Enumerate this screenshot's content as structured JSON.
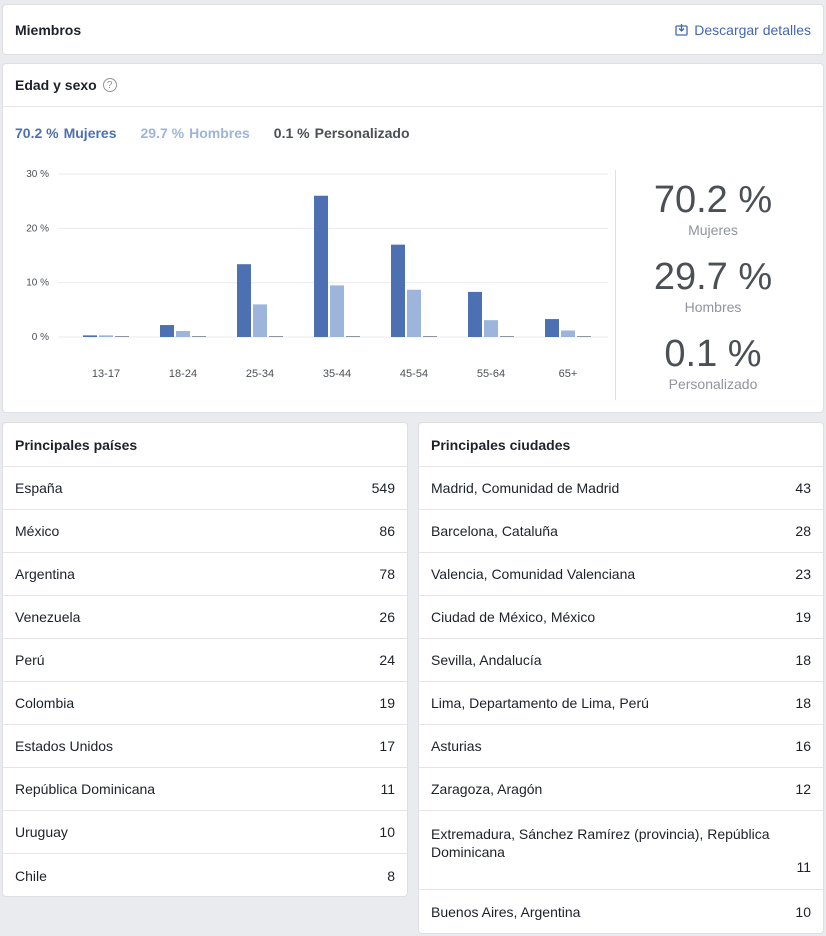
{
  "members": {
    "title": "Miembros",
    "download_label": "Descargar detalles"
  },
  "age_gender": {
    "title": "Edad y sexo",
    "help": "?",
    "legend": [
      {
        "pct": "70.2 %",
        "label": "Mujeres"
      },
      {
        "pct": "29.7 %",
        "label": "Hombres"
      },
      {
        "pct": "0.1 %",
        "label": "Personalizado"
      }
    ],
    "stats": [
      {
        "value": "70.2 %",
        "label": "Mujeres"
      },
      {
        "value": "29.7 %",
        "label": "Hombres"
      },
      {
        "value": "0.1 %",
        "label": "Personalizado"
      }
    ]
  },
  "chart_data": {
    "type": "bar",
    "categories": [
      "13-17",
      "18-24",
      "25-34",
      "35-44",
      "45-54",
      "55-64",
      "65+"
    ],
    "series": [
      {
        "name": "Mujeres",
        "color": "#4d70b2",
        "values": [
          0.3,
          2.2,
          13.4,
          26.0,
          17.0,
          8.3,
          3.3
        ]
      },
      {
        "name": "Hombres",
        "color": "#9db5dc",
        "values": [
          0.3,
          1.1,
          6.0,
          9.5,
          8.7,
          3.1,
          1.2
        ]
      },
      {
        "name": "Personalizado",
        "color": "#90949c",
        "values": [
          0.1,
          0.1,
          0.1,
          0.1,
          0.1,
          0.1,
          0.1
        ]
      }
    ],
    "ylim": [
      0,
      30
    ],
    "yticks": [
      "0 %",
      "10 %",
      "20 %",
      "30 %"
    ],
    "ytick_values": [
      0,
      10,
      20,
      30
    ],
    "grid": true
  },
  "countries": {
    "title": "Principales países",
    "rows": [
      {
        "name": "España",
        "value": "549"
      },
      {
        "name": "México",
        "value": "86"
      },
      {
        "name": "Argentina",
        "value": "78"
      },
      {
        "name": "Venezuela",
        "value": "26"
      },
      {
        "name": "Perú",
        "value": "24"
      },
      {
        "name": "Colombia",
        "value": "19"
      },
      {
        "name": "Estados Unidos",
        "value": "17"
      },
      {
        "name": "República Dominicana",
        "value": "11"
      },
      {
        "name": "Uruguay",
        "value": "10"
      },
      {
        "name": "Chile",
        "value": "8"
      }
    ]
  },
  "cities": {
    "title": "Principales ciudades",
    "rows": [
      {
        "name": "Madrid, Comunidad de Madrid",
        "value": "43"
      },
      {
        "name": "Barcelona, Cataluña",
        "value": "28"
      },
      {
        "name": "Valencia, Comunidad Valenciana",
        "value": "23"
      },
      {
        "name": "Ciudad de México, México",
        "value": "19"
      },
      {
        "name": "Sevilla, Andalucía",
        "value": "18"
      },
      {
        "name": "Lima, Departamento de Lima, Perú",
        "value": "18"
      },
      {
        "name": "Asturias",
        "value": "16"
      },
      {
        "name": "Zaragoza, Aragón",
        "value": "12"
      },
      {
        "name": "Extremadura, Sánchez Ramírez (provincia), República Dominicana",
        "value": "11"
      },
      {
        "name": "Buenos Aires, Argentina",
        "value": "10"
      }
    ]
  }
}
